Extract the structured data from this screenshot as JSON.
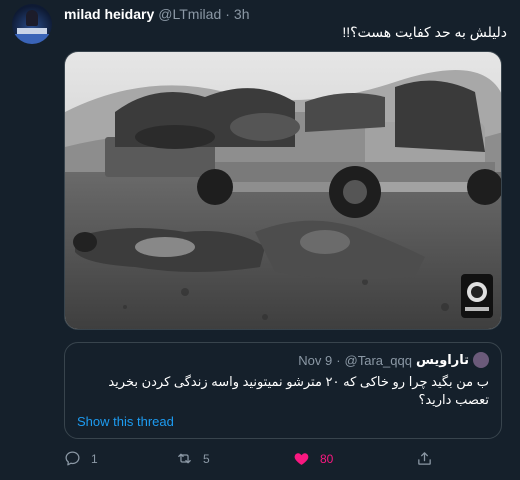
{
  "author": {
    "display_name": "milad heidary",
    "handle": "@LTmilad",
    "separator": "·",
    "time": "3h"
  },
  "tweet": {
    "text": "دلیلش به حد کفایت هست؟!!"
  },
  "media": {
    "description": "black and white war photograph"
  },
  "quoted_tweet": {
    "display_name": "تاراویس",
    "handle": "@Tara_qqq",
    "separator": "·",
    "time": "Nov 9",
    "text": "ب من بگید چرا رو خاکی که ۲۰ مترشو نمیتونید واسه زندگی کردن بخرید تعصب دارید؟",
    "link": "Show this thread"
  },
  "actions": {
    "reply": {
      "icon": "reply-icon",
      "count": "1"
    },
    "retweet": {
      "icon": "retweet-icon",
      "count": "5"
    },
    "like": {
      "icon": "heart-icon",
      "count": "80",
      "color": "#f91880"
    },
    "share": {
      "icon": "share-icon"
    }
  },
  "colors": {
    "background": "#15202b",
    "border": "#38444d",
    "secondary_text": "#8b98a5",
    "link": "#1d9bf0",
    "like": "#f91880"
  }
}
